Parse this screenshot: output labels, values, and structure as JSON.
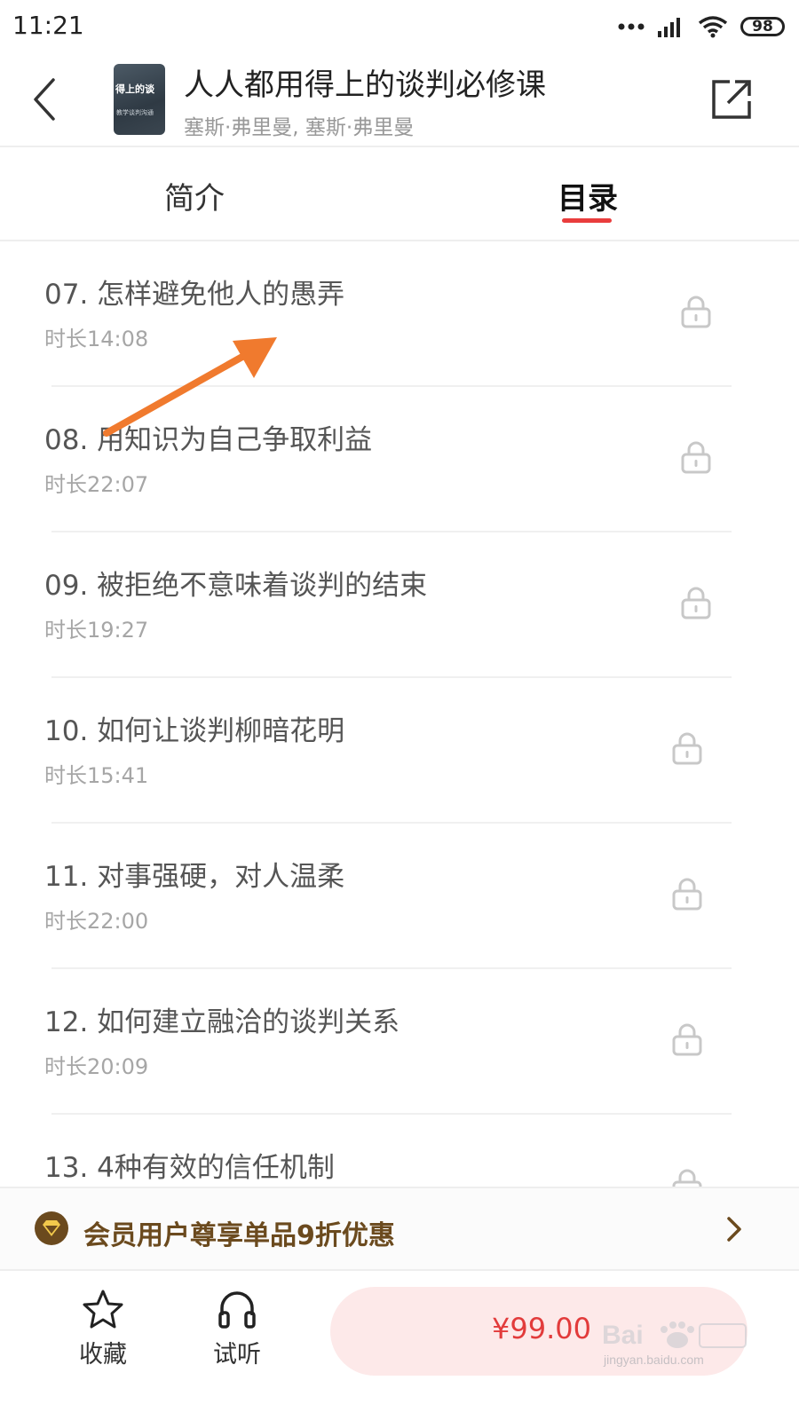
{
  "status_bar": {
    "time": "11:21",
    "battery": "98",
    "icons": [
      "more-dots-icon",
      "signal-icon",
      "wifi-icon",
      "battery-icon"
    ]
  },
  "header": {
    "cover": {
      "title": "得上的谈",
      "subtitle": "教学谈判沟通"
    },
    "title": "人人都用得上的谈判必修课",
    "authors": "塞斯·弗里曼, 塞斯·弗里曼",
    "icons": [
      "back-arrow-icon",
      "share-icon"
    ]
  },
  "tabs": [
    {
      "label": "简介",
      "active": false
    },
    {
      "label": "目录",
      "active": true
    }
  ],
  "accent_color": "#e93d3d",
  "chapters": [
    {
      "title": "07. 怎样避免他人的愚弄",
      "duration": "时长14:08",
      "locked": true
    },
    {
      "title": "08. 用知识为自己争取利益",
      "duration": "时长22:07",
      "locked": true
    },
    {
      "title": "09. 被拒绝不意味着谈判的结束",
      "duration": "时长19:27",
      "locked": true
    },
    {
      "title": "10. 如何让谈判柳暗花明",
      "duration": "时长15:41",
      "locked": true
    },
    {
      "title": "11. 对事强硬，对人温柔",
      "duration": "时长22:00",
      "locked": true
    },
    {
      "title": "12. 如何建立融洽的谈判关系",
      "duration": "时长20:09",
      "locked": true
    },
    {
      "title": "13. 4种有效的信任机制",
      "duration": "",
      "locked": true
    }
  ],
  "member_banner": {
    "text": "会员用户尊享单品9折优惠",
    "color": "#6b4a1e"
  },
  "bottom_bar": {
    "favorite_label": "收藏",
    "trial_label": "试听",
    "price": "¥99.00",
    "price_color": "#e23b3b"
  },
  "watermark": {
    "url": "jingyan.baidu.com"
  }
}
